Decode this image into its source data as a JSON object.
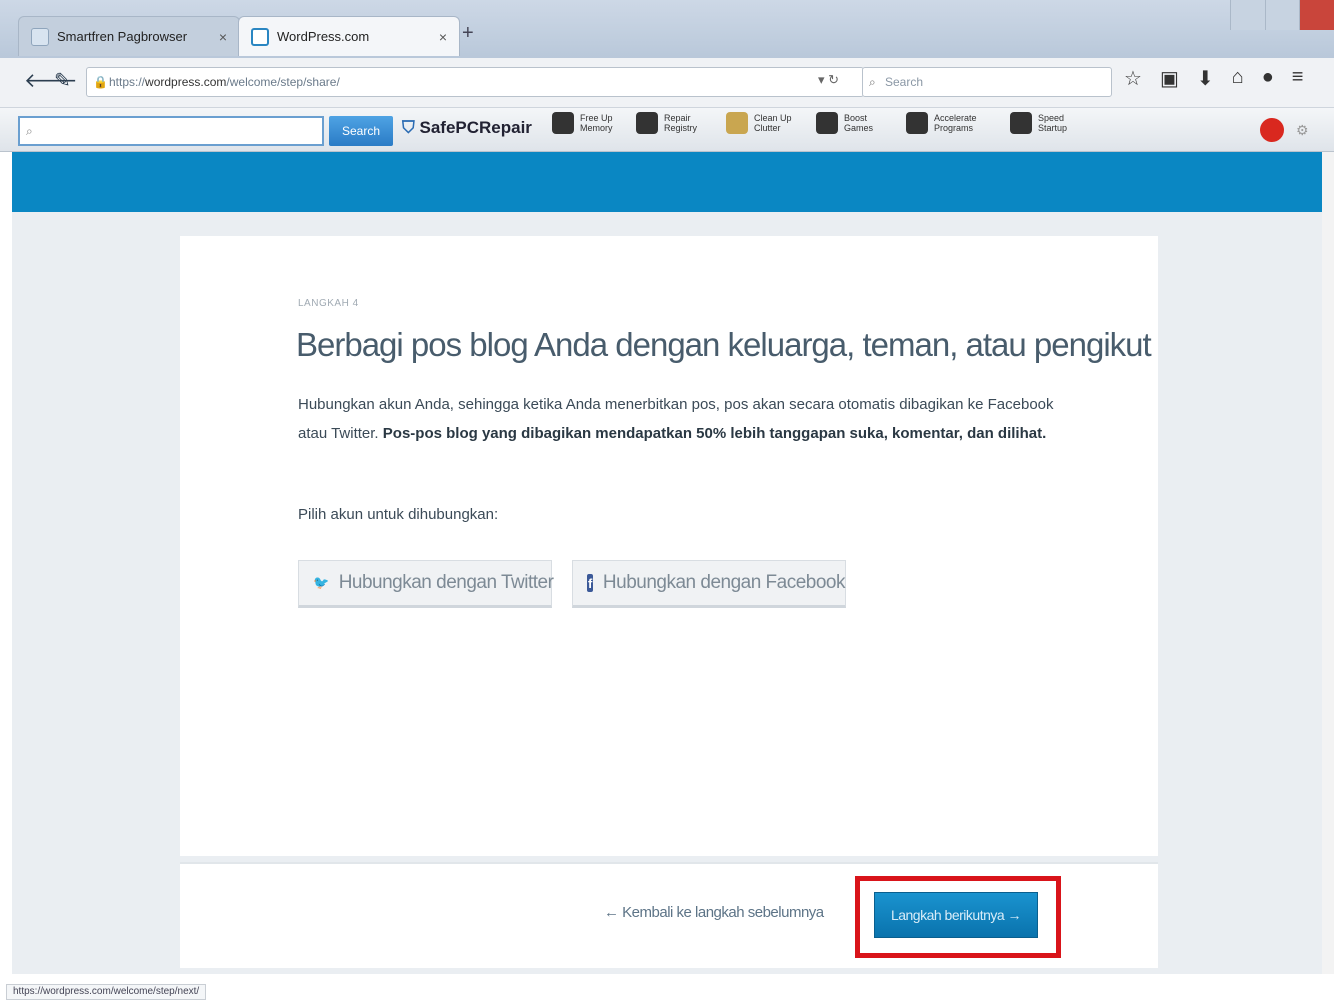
{
  "browser": {
    "tabs": [
      {
        "label": "Smartfren Pagbrowser",
        "active": false
      },
      {
        "label": "WordPress.com",
        "active": true
      }
    ],
    "new_tab": "+",
    "url_prefix": "https://",
    "url_domain": "wordpress.com",
    "url_path": "/welcome/step/share/",
    "search_placeholder": "Search",
    "toolbar_search_placeholder": "",
    "toolbar_search_button": "Search",
    "brand": "SafePCRepair",
    "toolbar_items": [
      {
        "label": "Free Up Memory",
        "icon": "memory-icon"
      },
      {
        "label": "Repair Registry",
        "icon": "registry-icon"
      },
      {
        "label": "Clean Up Clutter",
        "icon": "broom-icon"
      },
      {
        "label": "Boost Games",
        "icon": "gamepad-icon"
      },
      {
        "label": "Accelerate Programs",
        "icon": "programs-icon"
      },
      {
        "label": "Speed Startup",
        "icon": "startup-icon"
      }
    ],
    "status_url": "https://wordpress.com/welcome/step/next/"
  },
  "page": {
    "step_label": "LANGKAH 4",
    "title": "Berbagi pos blog Anda dengan keluarga, teman, atau pengikut",
    "description_plain": "Hubungkan akun Anda, sehingga ketika Anda menerbitkan pos, pos akan secara otomatis dibagikan ke Facebook atau Twitter.",
    "description_bold": "Pos-pos blog yang dibagikan mendapatkan 50% lebih tanggapan suka, komentar, dan dilihat.",
    "choose_label": "Pilih akun untuk dihubungkan:",
    "twitter_button": "Hubungkan dengan Twitter",
    "facebook_button": "Hubungkan dengan Facebook",
    "back_link": "← Kembali ke langkah sebelumnya",
    "next_button": "Langkah berikutnya →"
  },
  "colors": {
    "accent": "#0a87c3",
    "highlight": "#d9141a"
  }
}
